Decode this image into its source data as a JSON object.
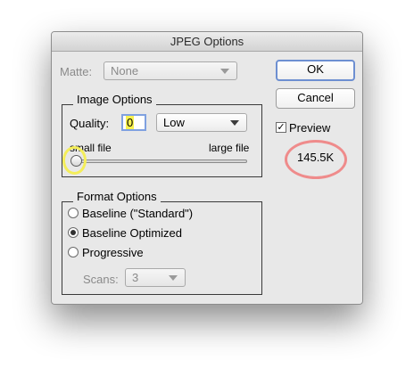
{
  "window": {
    "title": "JPEG Options"
  },
  "matte": {
    "label": "Matte:",
    "value": "None"
  },
  "image_options": {
    "title": "Image Options",
    "quality_label": "Quality:",
    "quality_value": "0",
    "quality_preset": "Low",
    "slider_min_label": "small file",
    "slider_max_label": "large file",
    "slider_value_fraction": 0.0
  },
  "format_options": {
    "title": "Format Options",
    "radios": [
      {
        "label": "Baseline (\"Standard\")",
        "checked": false
      },
      {
        "label": "Baseline Optimized",
        "checked": true
      },
      {
        "label": "Progressive",
        "checked": false
      }
    ],
    "scans_label": "Scans:",
    "scans_value": "3"
  },
  "buttons": {
    "ok": "OK",
    "cancel": "Cancel"
  },
  "preview": {
    "label": "Preview",
    "checked": true,
    "file_size": "145.5K"
  },
  "colors": {
    "annotation_yellow": "#f4ee5a",
    "annotation_pink": "#ef8b8b",
    "focus_blue": "#6d8fd1"
  }
}
